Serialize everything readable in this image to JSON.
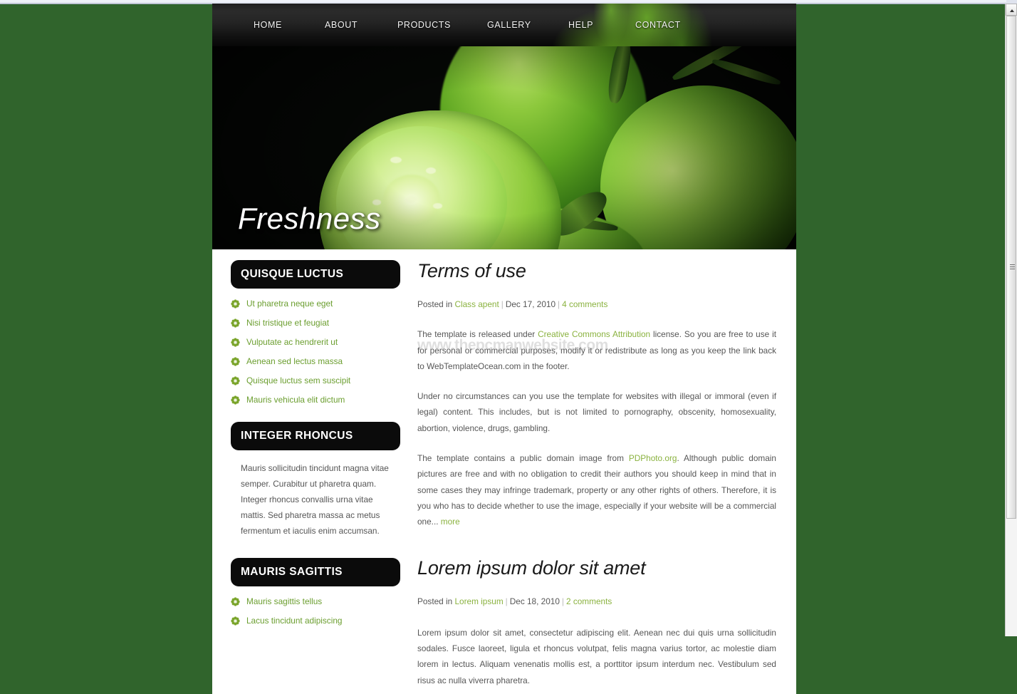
{
  "site": {
    "banner_title": "Freshness",
    "background_color": "#30642c",
    "accent_color": "#6b9e2f"
  },
  "nav": {
    "items": [
      {
        "label": "HOME"
      },
      {
        "label": "ABOUT"
      },
      {
        "label": "PRODUCTS"
      },
      {
        "label": "GALLERY"
      },
      {
        "label": "HELP"
      },
      {
        "label": "CONTACT"
      }
    ]
  },
  "sidebar": {
    "widgets": [
      {
        "title": "QUISQUE LUCTUS",
        "type": "list",
        "items": [
          {
            "label": "Ut pharetra neque eget"
          },
          {
            "label": "Nisi tristique et feugiat"
          },
          {
            "label": "Vulputate ac hendrerit ut"
          },
          {
            "label": "Aenean sed lectus massa"
          },
          {
            "label": "Quisque luctus sem suscipit"
          },
          {
            "label": "Mauris vehicula elit dictum"
          }
        ]
      },
      {
        "title": "INTEGER RHONCUS",
        "type": "text",
        "text": "Mauris sollicitudin tincidunt magna vitae semper. Curabitur ut pharetra quam. Integer rhoncus convallis urna vitae mattis. Sed pharetra massa ac metus fermentum et iaculis enim accumsan."
      },
      {
        "title": "MAURIS SAGITTIS",
        "type": "list",
        "items": [
          {
            "label": "Mauris sagittis tellus"
          },
          {
            "label": "Lacus tincidunt adipiscing"
          }
        ]
      }
    ]
  },
  "main": {
    "watermark": "www.thepcmanwebsite.com",
    "posts": [
      {
        "title": "Terms of use",
        "meta": {
          "posted_in_label": "Posted in",
          "category": "Class apent",
          "date": "Dec 17, 2010",
          "comments": "4 comments"
        },
        "paragraphs": [
          {
            "parts": [
              {
                "text": "The template is released under ",
                "link": false
              },
              {
                "text": "Creative Commons Attribution",
                "link": true
              },
              {
                "text": " license. So you are free to use it for personal or commercial purposes, modify it or redistribute as long as you keep the link back to WebTemplateOcean.com in the footer.",
                "link": false
              }
            ]
          },
          {
            "parts": [
              {
                "text": "Under no circumstances can you use the template for websites with illegal or immoral (even if legal) content. This includes, but is not limited to pornography, obscenity, homosexuality, abortion, violence, drugs, gambling.",
                "link": false
              }
            ]
          },
          {
            "parts": [
              {
                "text": "The template contains a public domain image from ",
                "link": false
              },
              {
                "text": "PDPhoto.org",
                "link": true
              },
              {
                "text": ". Although public domain pictures are free and with no obligation to credit their authors you should keep in mind that in some cases they may infringe trademark, property or any other rights of others. Therefore, it is you who has to decide whether to use the image, especially if your website will be a commercial one... ",
                "link": false
              },
              {
                "text": "more",
                "link": true
              }
            ]
          }
        ]
      },
      {
        "title": "Lorem ipsum dolor sit amet",
        "meta": {
          "posted_in_label": "Posted in",
          "category": "Lorem ipsum",
          "date": "Dec 18, 2010",
          "comments": "2 comments"
        },
        "paragraphs": [
          {
            "parts": [
              {
                "text": "Lorem ipsum dolor sit amet, consectetur adipiscing elit. Aenean nec dui quis urna sollicitudin sodales. Fusce laoreet, ligula et rhoncus volutpat, felis magna varius tortor, ac molestie diam lorem in lectus. Aliquam venenatis mollis est, a porttitor ipsum interdum nec. Vestibulum sed risus ac nulla viverra pharetra.",
                "link": false
              }
            ]
          }
        ]
      }
    ]
  },
  "browser": {
    "scrollbar": {
      "position": "right"
    }
  }
}
